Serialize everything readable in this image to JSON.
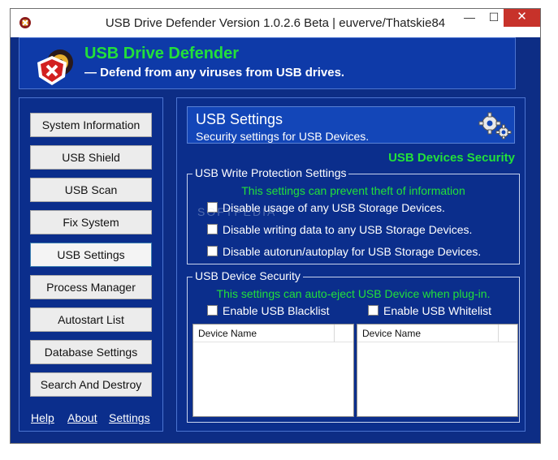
{
  "window": {
    "title": "USB Drive Defender Version 1.0.2.6 Beta | euverve/Thatskie84",
    "controls": {
      "minimize": "—",
      "maximize": "☐",
      "close": "✕"
    }
  },
  "header": {
    "app_name": "USB Drive Defender",
    "tagline": "— Defend from any viruses from USB drives."
  },
  "nav": {
    "items": [
      {
        "label": "System Information"
      },
      {
        "label": "USB Shield"
      },
      {
        "label": "USB Scan"
      },
      {
        "label": "Fix System"
      },
      {
        "label": "USB Settings"
      },
      {
        "label": "Process Manager"
      },
      {
        "label": "Autostart List"
      },
      {
        "label": "Database Settings"
      },
      {
        "label": "Search And Destroy"
      }
    ],
    "active_index": 4,
    "links": {
      "help": "Help",
      "about": "About",
      "settings": "Settings"
    }
  },
  "main": {
    "title": "USB Settings",
    "subtitle": "Security settings for USB Devices.",
    "section_heading": "USB Devices Security",
    "write_protection": {
      "legend": "USB Write Protection Settings",
      "note": "This settings can prevent theft of information",
      "options": [
        {
          "label": "Disable usage of any USB Storage Devices.",
          "checked": false
        },
        {
          "label": "Disable writing data to any USB Storage Devices.",
          "checked": false
        },
        {
          "label": "Disable autorun/autoplay for USB Storage Devices.",
          "checked": false
        }
      ]
    },
    "device_security": {
      "legend": "USB Device Security",
      "note": "This settings can auto-eject USB Device when plug-in.",
      "blacklist": {
        "label": "Enable USB Blacklist",
        "checked": false,
        "column": "Device Name"
      },
      "whitelist": {
        "label": "Enable USB Whitelist",
        "checked": false,
        "column": "Device Name"
      }
    }
  },
  "watermark": "SOFTPEDIA",
  "colors": {
    "background": "#0b2e8c",
    "accent_green": "#22e03a",
    "close": "#c7322a"
  }
}
